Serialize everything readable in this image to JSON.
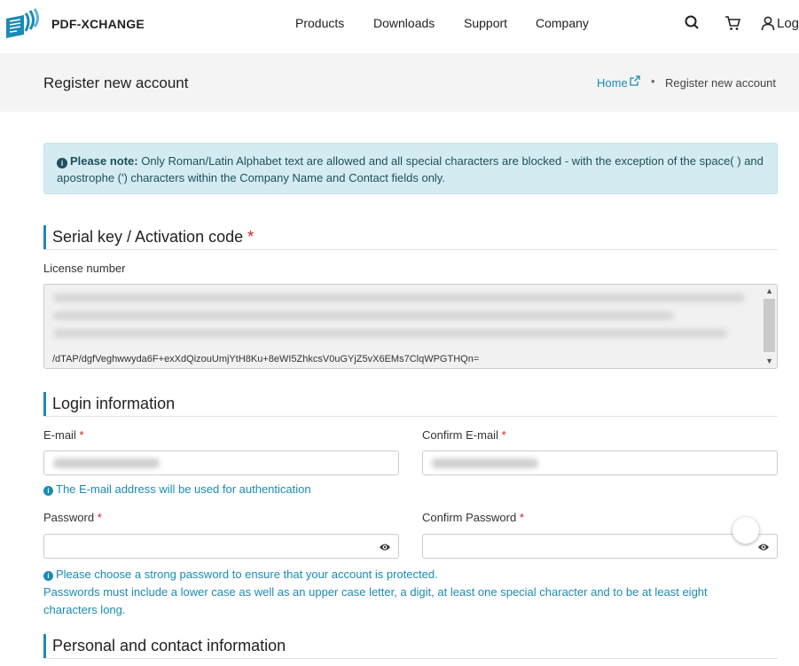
{
  "nav": {
    "brand": "PDF-XCHANGE",
    "items": [
      "Products",
      "Downloads",
      "Support",
      "Company"
    ],
    "icons": [
      "search-icon",
      "cart-icon",
      "user-icon"
    ],
    "login_label": "Log"
  },
  "header": {
    "title": "Register new account",
    "breadcrumb": {
      "home": "Home",
      "separator": "•",
      "current": "Register new account"
    }
  },
  "alert": {
    "strong": "Please note:",
    "text": " Only Roman/Latin Alphabet text are allowed and all special characters are blocked - with the exception of the space( ) and apostrophe (') characters within the Company Name and Contact fields only."
  },
  "sections": {
    "serial": "Serial key / Activation code",
    "login": "Login information",
    "personal": "Personal and contact information"
  },
  "required_mark": "*",
  "license": {
    "label": "License number",
    "visible_text": "/dTAP/dgfVeghwwyda6F+exXdQizouUmjYtH8Ku+8eWI5ZhkcsV0uGYjZ5vX6EMs7ClqWPGTHQn="
  },
  "fields": {
    "email_label": "E-mail",
    "confirm_email_label": "Confirm E-mail",
    "email_hint": "The E-mail address will be used for authentication",
    "password_label": "Password",
    "confirm_password_label": "Confirm Password",
    "password_hint_1": "Please choose a strong password to ensure that your account is protected.",
    "password_hint_2": "Passwords must include a lower case as well as an upper case letter, a digit, at least one special character and to be at least eight characters long."
  },
  "colors": {
    "accent": "#1a8bb3",
    "alert_bg": "#d4ecf1",
    "required": "#d01c1c",
    "band_bg": "#f4f4f4"
  }
}
